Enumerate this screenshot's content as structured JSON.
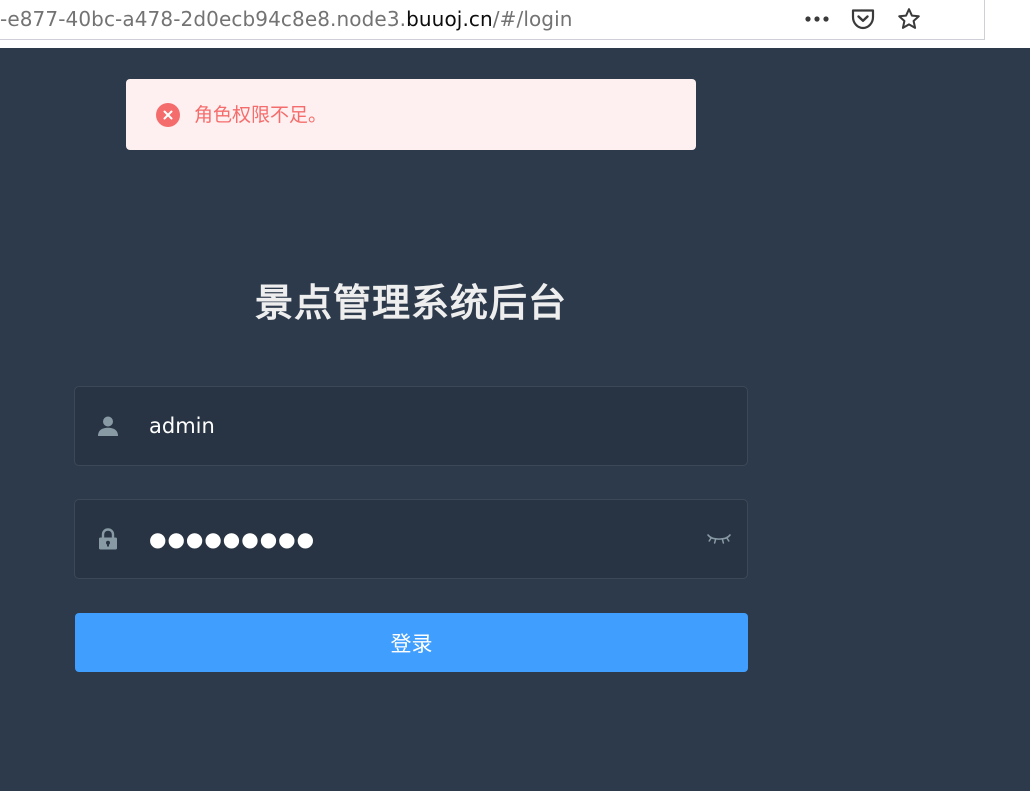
{
  "browser": {
    "url_prefix": "-e877-40bc-a478-2d0ecb94c8e8.node3.",
    "url_host": "buuoj.cn",
    "url_path": "/#/login",
    "icons": [
      "more-icon",
      "pocket-icon",
      "bookmark-star-icon"
    ]
  },
  "alert": {
    "type": "error",
    "message": "角色权限不足。",
    "icon": "close-circle-icon",
    "color": "#f56c6c",
    "background": "#fef0f0"
  },
  "login": {
    "title": "景点管理系统后台",
    "username": {
      "value": "admin",
      "icon": "user-icon"
    },
    "password": {
      "value": "●●●●●●●●●",
      "icon": "lock-icon",
      "toggle_icon": "eye-closed-icon"
    },
    "submit_label": "登录",
    "colors": {
      "background": "#2d3a4b",
      "field_background": "#283443",
      "button": "#409eff"
    }
  }
}
